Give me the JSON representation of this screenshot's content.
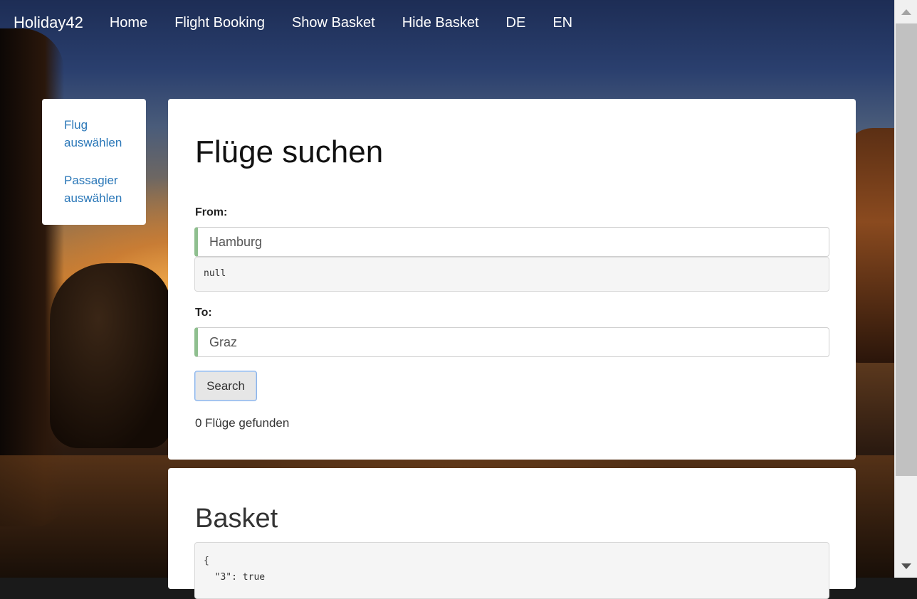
{
  "navbar": {
    "brand": "Holiday42",
    "links": [
      "Home",
      "Flight Booking",
      "Show Basket",
      "Hide Basket",
      "DE",
      "EN"
    ]
  },
  "sidebar": {
    "items": [
      {
        "label": "Flug auswählen"
      },
      {
        "label": "Passagier auswählen"
      }
    ]
  },
  "search": {
    "title": "Flüge suchen",
    "from_label": "From:",
    "from_value": "Hamburg",
    "from_debug": "null",
    "to_label": "To:",
    "to_value": "Graz",
    "search_button": "Search",
    "result_text": "0 Flüge gefunden"
  },
  "basket": {
    "title": "Basket",
    "json_line1": "{",
    "json_line2": "  \"3\": true"
  },
  "colors": {
    "link": "#2a77b8",
    "input_valid_border": "#8fbf8f",
    "button_focus": "#8db4e8"
  }
}
